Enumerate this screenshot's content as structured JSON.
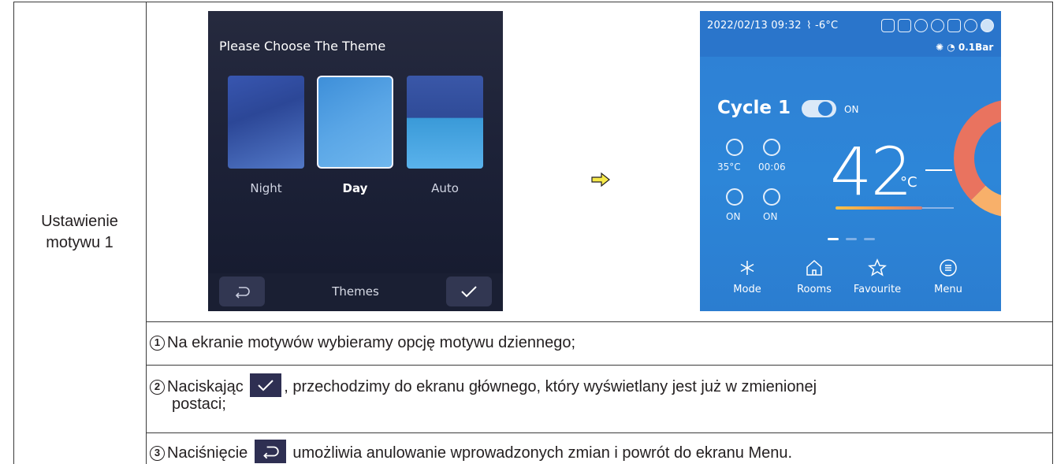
{
  "row_label": "Ustawienie motywu 1",
  "themes_screen": {
    "title": "Please Choose The Theme",
    "options": [
      {
        "label": "Night",
        "selected": false
      },
      {
        "label": "Day",
        "selected": true
      },
      {
        "label": "Auto",
        "selected": false
      }
    ],
    "bottom_label": "Themes",
    "back_icon": "return-icon",
    "confirm_icon": "check-icon"
  },
  "transition_icon": "arrow-right-icon",
  "home_screen": {
    "date_time": "2022/02/13  09:32",
    "outdoor_temp": "-6°C",
    "pressure": "0.1Bar",
    "cycle_title": "Cycle 1",
    "cycle_state": "ON",
    "water_temp": "35°C",
    "timer": "00:06",
    "schedule_state": "ON",
    "eco_state": "ON",
    "big_temp": "42",
    "big_unit": "°C",
    "nav": [
      {
        "label": "Mode",
        "icon": "mode-snowflake-icon"
      },
      {
        "label": "Rooms",
        "icon": "house-icon"
      },
      {
        "label": "Favourite",
        "icon": "star-icon"
      },
      {
        "label": "Menu",
        "icon": "menu-list-icon"
      }
    ]
  },
  "steps": [
    {
      "num": "1",
      "text": "Na ekranie motywów wybieramy opcję motywu dziennego;"
    },
    {
      "num": "2",
      "text_before": "Naciskając",
      "text_after": ", przechodzimy do ekranu głównego, który wyświetlany jest już w zmienionej",
      "text_line2": "postaci;"
    },
    {
      "num": "3",
      "text_before": "Naciśnięcie",
      "text_after": "umożliwia anulowanie wprowadzonych zmian i powrót do ekranu Menu."
    }
  ],
  "colors": {
    "dark_screen": "#1d2238",
    "home_blue": "#2e80d4",
    "gauge_orange": "#f18b55",
    "inline_button": "#2e2f52",
    "arrow_yellow": "#f6e94a"
  }
}
